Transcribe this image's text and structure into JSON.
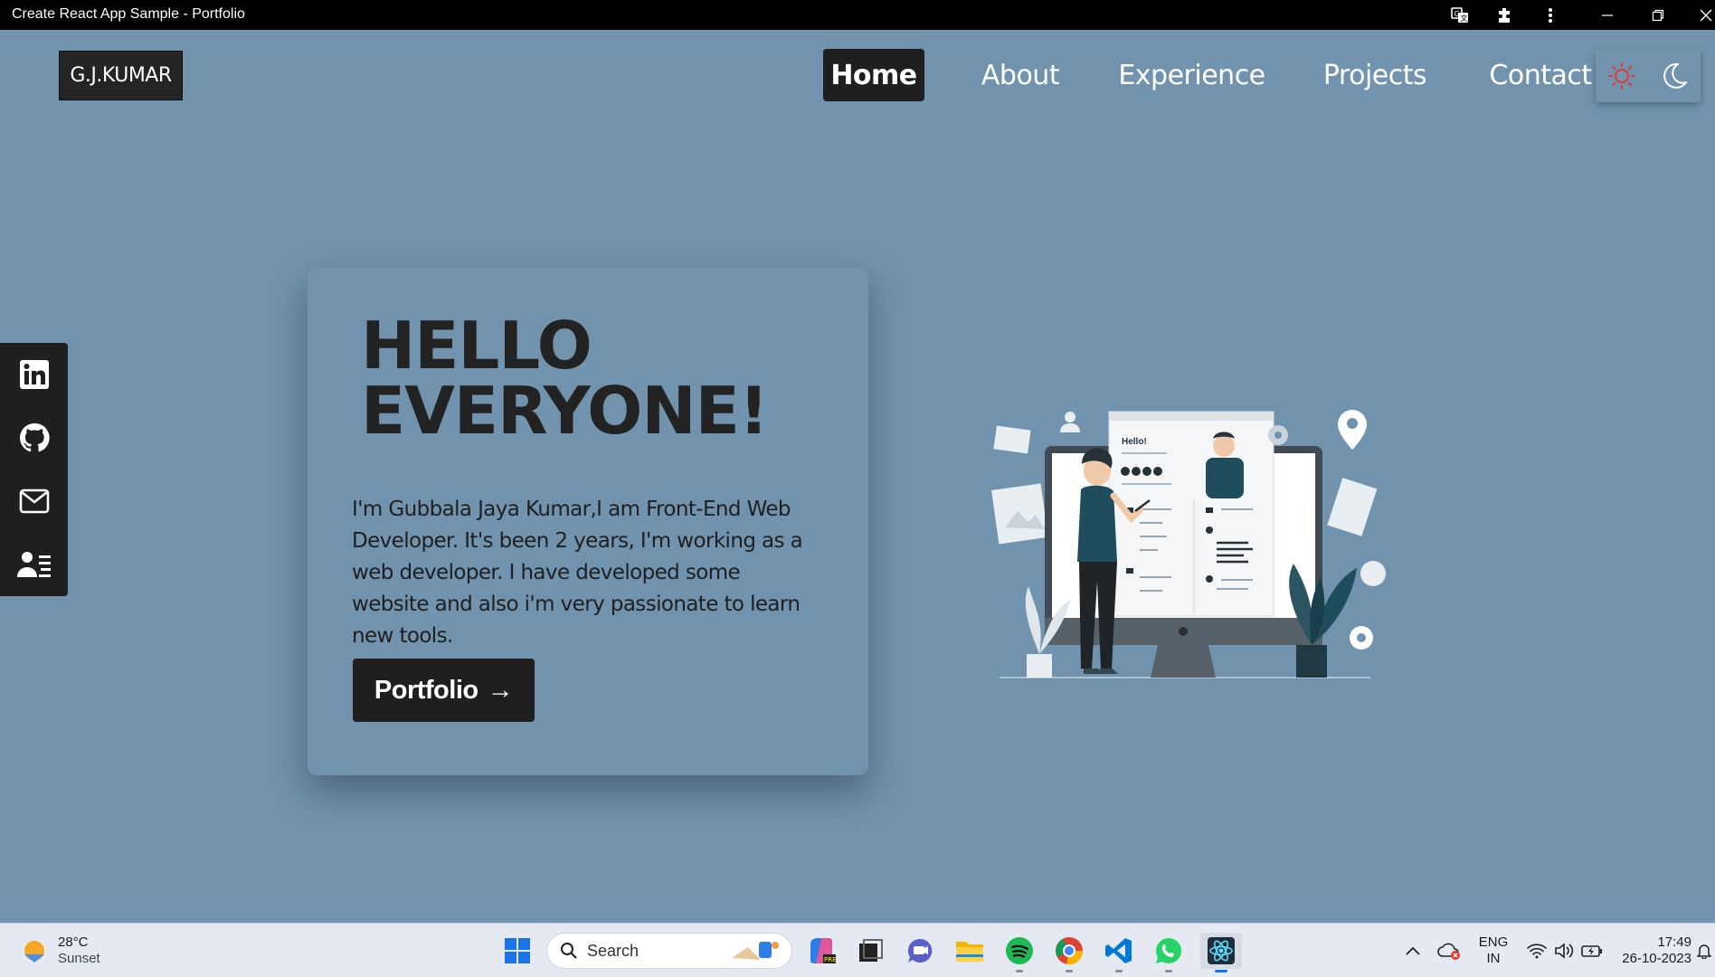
{
  "window": {
    "title": "Create React App Sample - Portfolio"
  },
  "header": {
    "logo": "G.J.KUMAR",
    "nav": [
      {
        "label": "Home",
        "active": true
      },
      {
        "label": "About",
        "active": false
      },
      {
        "label": "Experience",
        "active": false
      },
      {
        "label": "Projects",
        "active": false
      },
      {
        "label": "Contact",
        "active": false
      }
    ],
    "theme_icons": [
      "sun-icon",
      "moon-icon"
    ],
    "accent_sun_color": "#e53935"
  },
  "social": [
    "linkedin-icon",
    "github-icon",
    "mail-icon",
    "contact-card-icon"
  ],
  "hero": {
    "title_line1": "HELLO",
    "title_line2": "EVERYONE!",
    "text": "I'm Gubbala Jaya Kumar,I am Front-End Web Developer. It's been 2 years, I'm working as a web developer. I have developed some website and also i'm very passionate to learn new tools.",
    "cta_label": "Portfolio",
    "cta_arrow": "→"
  },
  "illustration": {
    "hello_text": "Hello!"
  },
  "taskbar": {
    "weather_temp": "28°C",
    "weather_desc": "Sunset",
    "search_label": "Search",
    "lang_line1": "ENG",
    "lang_line2": "IN",
    "time": "17:49",
    "date": "26-10-2023"
  },
  "colors": {
    "page_bg": "#7193ad",
    "dark": "#1f1f1f"
  }
}
